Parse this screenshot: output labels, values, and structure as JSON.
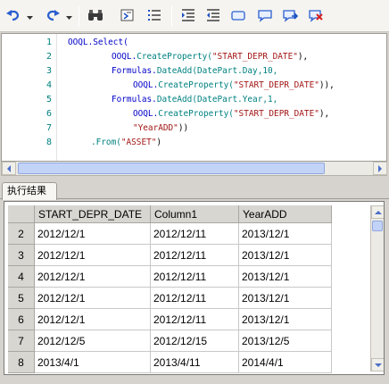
{
  "toolbar": {
    "icons": [
      "undo-icon",
      "redo-icon",
      "find-icon",
      "comment-icon",
      "list-icon",
      "indent-icon",
      "outdent-icon",
      "rectangle-icon",
      "callout-icon",
      "callout-arrow-icon",
      "callout-delete-icon"
    ]
  },
  "editor": {
    "line_numbers": [
      "1",
      "2",
      "3",
      "4",
      "5",
      "6",
      "7",
      "8"
    ],
    "lines": [
      [
        {
          "t": "OOQL.Select(",
          "c": "c-blue"
        }
      ],
      [
        {
          "t": "OOQL.",
          "c": "c-blue"
        },
        {
          "t": "CreateProperty(",
          "c": "c-teal"
        },
        {
          "t": "\"START_DEPR_DATE\"",
          "c": "c-red"
        },
        {
          "t": "),",
          "c": "c-black"
        }
      ],
      [
        {
          "t": "Formulas.",
          "c": "c-blue"
        },
        {
          "t": "DateAdd(DatePart.Day,10,",
          "c": "c-teal"
        }
      ],
      [
        {
          "t": "OOQL.",
          "c": "c-blue"
        },
        {
          "t": "CreateProperty(",
          "c": "c-teal"
        },
        {
          "t": "\"START_DEPR_DATE\"",
          "c": "c-red"
        },
        {
          "t": ")),",
          "c": "c-black"
        }
      ],
      [
        {
          "t": "Formulas.",
          "c": "c-blue"
        },
        {
          "t": "DateAdd(DatePart.Year,1,",
          "c": "c-teal"
        }
      ],
      [
        {
          "t": "OOQL.",
          "c": "c-blue"
        },
        {
          "t": "CreateProperty(",
          "c": "c-teal"
        },
        {
          "t": "\"START_DEPR_DATE\"",
          "c": "c-red"
        },
        {
          "t": "),",
          "c": "c-black"
        }
      ],
      [
        {
          "t": "\"YearADD\"",
          "c": "c-red"
        },
        {
          "t": "))",
          "c": "c-black"
        }
      ],
      [
        {
          "t": ".From(",
          "c": "c-teal"
        },
        {
          "t": "\"ASSET\"",
          "c": "c-red"
        },
        {
          "t": ")",
          "c": "c-black"
        }
      ]
    ]
  },
  "results": {
    "tab_label": "执行结果",
    "columns": [
      "START_DEPR_DATE",
      "Column1",
      "YearADD"
    ],
    "rows": [
      {
        "num": "2",
        "cells": [
          "2012/12/1",
          "2012/12/11",
          "2013/12/1"
        ]
      },
      {
        "num": "3",
        "cells": [
          "2012/12/1",
          "2012/12/11",
          "2013/12/1"
        ]
      },
      {
        "num": "4",
        "cells": [
          "2012/12/1",
          "2012/12/11",
          "2013/12/1"
        ]
      },
      {
        "num": "5",
        "cells": [
          "2012/12/1",
          "2012/12/11",
          "2013/12/1"
        ]
      },
      {
        "num": "6",
        "cells": [
          "2012/12/1",
          "2012/12/11",
          "2013/12/1"
        ]
      },
      {
        "num": "7",
        "cells": [
          "2012/12/5",
          "2012/12/15",
          "2013/12/5"
        ]
      },
      {
        "num": "8",
        "cells": [
          "2013/4/1",
          "2013/4/11",
          "2014/4/1"
        ]
      }
    ]
  },
  "colors": {
    "keyword": "#0000c8",
    "method": "#008080",
    "string": "#a31515"
  }
}
